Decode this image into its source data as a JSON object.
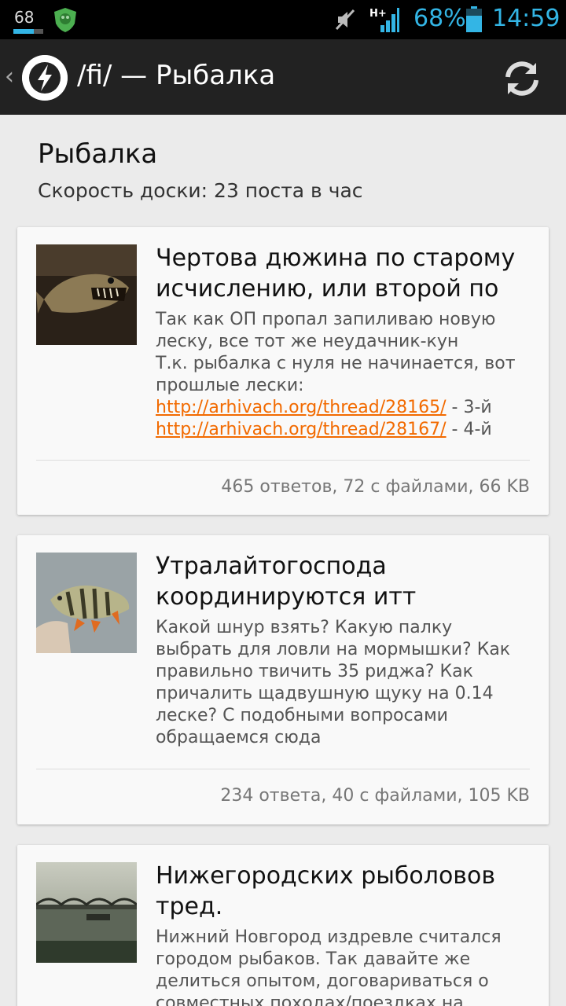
{
  "status_bar": {
    "battery_level_text": "68",
    "battery_level": 0.68,
    "battery_percent": "68%",
    "time": "14:59",
    "network_label": "H+",
    "accent_color": "#33b5e5"
  },
  "action_bar": {
    "back_glyph": "‹",
    "title": "/fi/ — Рыбалка",
    "refresh_icon": "refresh-icon"
  },
  "board": {
    "name": "Рыбалка",
    "speed": "Скорость доски: 23 поста в час"
  },
  "threads": [
    {
      "title": "Чертова дюжина по старому исчислению, или второй по",
      "body_lines": [
        "Так как ОП пропал запиливаю новую леску, все тот же неудачник-кун",
        "Т.к. рыбалка с нуля не начинается, вот прошлые лески:"
      ],
      "links": [
        {
          "url": "http://arhivach.org/thread/28165/",
          "suffix": " - 3-й"
        },
        {
          "url": "http://arhivach.org/thread/28167/",
          "suffix": " - 4-й"
        }
      ],
      "stats": "465 ответов, 72 с файлами, 66 KB"
    },
    {
      "title": "Утралайтогоспода координируются итт",
      "body_lines": [
        "Какой шнур взять? Какую палку выбрать для ловли на мормышки? Как правильно твичить 35 риджа? Как причалить щадвушную щуку на 0.14 леске? С подобными вопросами обращаемся сюда"
      ],
      "links": [],
      "stats": "234 ответа, 40 с файлами, 105 KB"
    },
    {
      "title": "Нижегородских рыболовов тред.",
      "body_lines": [
        "Нижний Новгород издревле считался городом рыбаков. Так давайте же делиться опытом, договариваться о совместных походах/поездках на"
      ],
      "links": [],
      "stats": ""
    }
  ]
}
